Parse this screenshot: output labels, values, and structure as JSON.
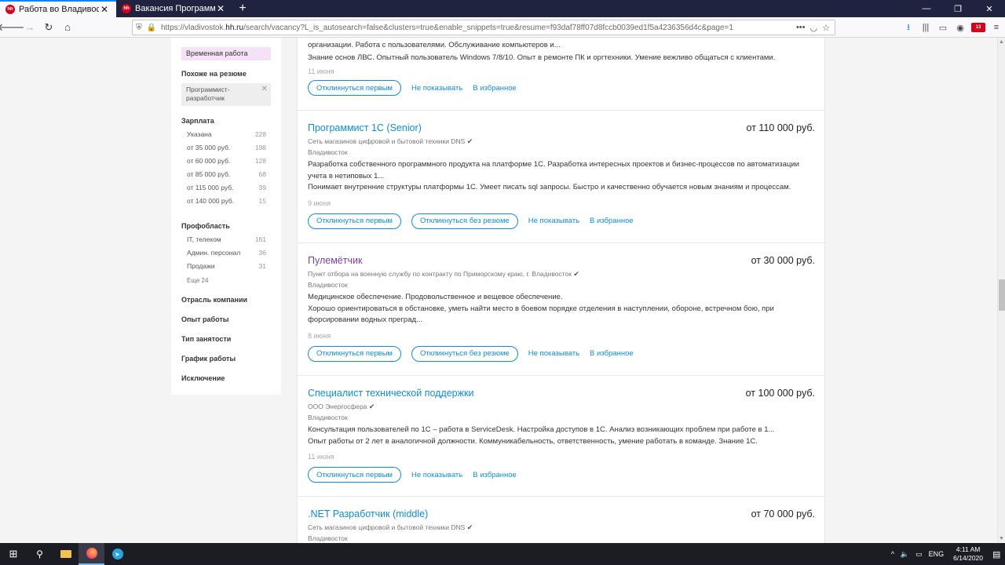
{
  "browser": {
    "tabs": [
      {
        "title": "Работа во Владивостоке, поис",
        "active": true
      },
      {
        "title": "Вакансия Программист C# в",
        "active": false
      }
    ],
    "url_prefix": "https://vladivostok.",
    "url_host": "hh.ru",
    "url_rest": "/search/vacancy?L_is_autosearch=false&clusters=true&enable_snippets=true&resume=f93daf78ff07d8fccb0039ed1f5a4236356d4c&page=1",
    "abp_badge": "13"
  },
  "sidebar": {
    "temp_chip": "Временная работа",
    "similar_heading": "Похоже на резюме",
    "similar_chip_line1": "Программист-",
    "similar_chip_line2": "разработчик",
    "salary_heading": "Зарплата",
    "salary_items": [
      {
        "label": "Указана",
        "count": "228"
      },
      {
        "label": "от 35 000 руб.",
        "count": "198"
      },
      {
        "label": "от 60 000 руб.",
        "count": "128"
      },
      {
        "label": "от 85 000 руб.",
        "count": "68"
      },
      {
        "label": "от 115 000 руб.",
        "count": "39"
      },
      {
        "label": "от 140 000 руб.",
        "count": "15"
      }
    ],
    "prof_heading": "Профобласть",
    "prof_items": [
      {
        "label": "IT, телеком",
        "count": "161"
      },
      {
        "label": "Админ. персонал",
        "count": "36"
      },
      {
        "label": "Продажи",
        "count": "31"
      }
    ],
    "prof_more": "Еще 24",
    "links": [
      "Отрасль компании",
      "Опыт работы",
      "Тип занятости",
      "График работы",
      "Исключение"
    ]
  },
  "vacancies": [
    {
      "resp": "организации. Работа с пользователями. Обслуживание компьютеров и...",
      "req": "Знание основ ЛВС. Опытный пользователь Windows 7/8/10. Опыт в ремонте ПК и оргтехники. Умение вежливо общаться с клиентами.",
      "date": "11 июня"
    },
    {
      "title": "Программист 1С (Senior)",
      "salary": "от 110 000 руб.",
      "company": "Сеть магазинов цифровой и бытовой техники DNS",
      "city": "Владивосток",
      "resp": "Разработка собственного программного продукта на платформе 1С. Разработка интересных проектов и бизнес-процессов по автоматизации учета в нетиповых 1...",
      "req": "Понимает внутренние структуры платформы 1С. Умеет писать sql запросы. Быстро и качественно обучается новым знаниям и процессам.",
      "date": "9 июня"
    },
    {
      "title": "Пулемётчик",
      "salary": "от 30 000 руб.",
      "company": "Пункт отбора на военную службу по контракту по Приморскому краю, г. Владивосток",
      "city": "Владивосток",
      "resp": "Медицинское обеспечение. Продовольственное и вещевое обеспечение.",
      "req": "Хорошо ориентироваться в обстановке, уметь найти место в боевом порядке отделения в наступлении, обороне, встречном бою, при форсировании водных преград...",
      "date": "8 июня"
    },
    {
      "title": "Специалист технической поддержки",
      "salary": "от 100 000 руб.",
      "company": "ООО Энергосфера",
      "city": "Владивосток",
      "resp": "Консультация пользователей по 1С – работа в ServiceDesk. Настройка доступов в 1С. Анализ возникающих проблем при работе в 1...",
      "req": "Опыт работы от 2 лет в аналогичной должности. Коммуникабельность, ответственность, умение работать в команде. Знание 1С.",
      "date": "11 июня"
    },
    {
      "title": ".NET Разработчик (middle)",
      "salary": "от 70 000 руб.",
      "company": "Сеть магазинов цифровой и бытовой техники DNS",
      "city": "Владивосток"
    }
  ],
  "actions": {
    "respond_first": "Откликнуться первым",
    "respond_no_resume": "Откликнуться без резюме",
    "hide": "Не показывать",
    "favorite": "В избранное"
  },
  "taskbar": {
    "lang": "ENG",
    "time": "4:11 AM",
    "date": "6/14/2020"
  }
}
